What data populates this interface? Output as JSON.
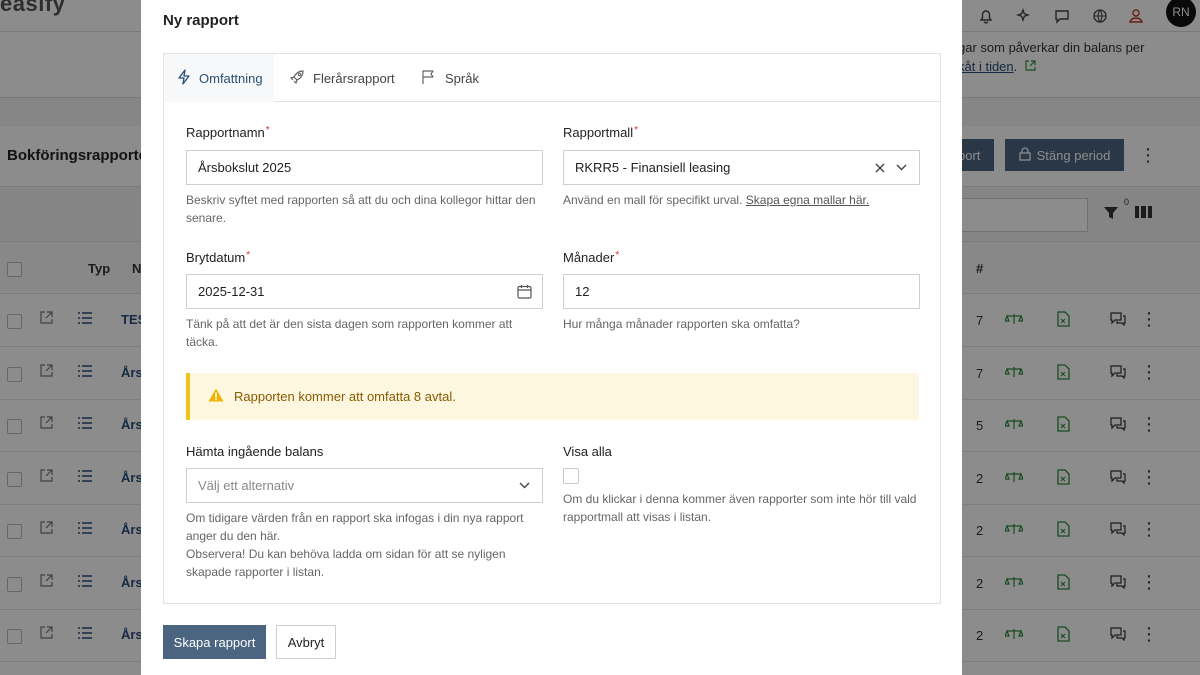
{
  "background": {
    "logo": "easify",
    "avatar_initials": "RN",
    "info_line1": "gar som påverkar din balans per",
    "info_link": "kåt i tiden",
    "info_trailing": ".",
    "card_title": "Bokföringsrapporter",
    "btn_left_label": "port",
    "btn_close_period_label": "Stäng period",
    "filter_count": "0",
    "table_headers": {
      "type": "Typ",
      "name": "N",
      "count": "#"
    },
    "rows": [
      {
        "name": "TES",
        "count": "7"
      },
      {
        "name": "Års",
        "count": "7"
      },
      {
        "name": "Års",
        "count": "5"
      },
      {
        "name": "Års",
        "count": "2"
      },
      {
        "name": "Års",
        "count": "2"
      },
      {
        "name": "Års",
        "count": "2"
      },
      {
        "name": "Års",
        "count": "2"
      }
    ]
  },
  "modal": {
    "title": "Ny rapport",
    "tabs": [
      {
        "label": "Omfattning",
        "icon": "bolt-icon",
        "active": true
      },
      {
        "label": "Flerårsrapport",
        "icon": "rocket-icon",
        "active": false
      },
      {
        "label": "Språk",
        "icon": "flag-icon",
        "active": false
      }
    ],
    "fields": {
      "report_name": {
        "label": "Rapportnamn",
        "required_mark": "*",
        "value": "Årsbokslut 2025",
        "help": "Beskriv syftet med rapporten så att du och dina kollegor hittar den senare."
      },
      "report_template": {
        "label": "Rapportmall",
        "required_mark": "*",
        "value": "RKRR5 - Finansiell leasing",
        "help_prefix": "Använd en mall för specifikt urval.",
        "help_link": "Skapa egna mallar här."
      },
      "cutoff_date": {
        "label": "Brytdatum",
        "required_mark": "*",
        "value": "2025-12-31",
        "help": "Tänk på att det är den sista dagen som rapporten kommer att täcka."
      },
      "months": {
        "label": "Månader",
        "required_mark": "*",
        "value": "12",
        "help": "Hur många månader rapporten ska omfatta?"
      },
      "opening_balance": {
        "label": "Hämta ingående balans",
        "placeholder": "Välj ett alternativ",
        "help_line1": "Om tidigare värden från en rapport ska infogas i din nya rapport anger du den här.",
        "help_line2": "Observera! Du kan behöva ladda om sidan för att se nyligen skapade rapporter i listan."
      },
      "show_all": {
        "label": "Visa alla",
        "checked": false,
        "help": "Om du klickar i denna kommer även rapporter som inte hör till vald rapportmall att visas i listan."
      }
    },
    "alert": {
      "text": "Rapporten kommer att omfatta 8 avtal.",
      "color": "#f0c419"
    },
    "buttons": {
      "create_label": "Skapa rapport",
      "cancel_label": "Avbryt"
    }
  },
  "colors": {
    "primary": "#4b6580",
    "link": "#2a4d7a",
    "required": "#d9342b",
    "warning_bg": "#fdf7e0"
  }
}
